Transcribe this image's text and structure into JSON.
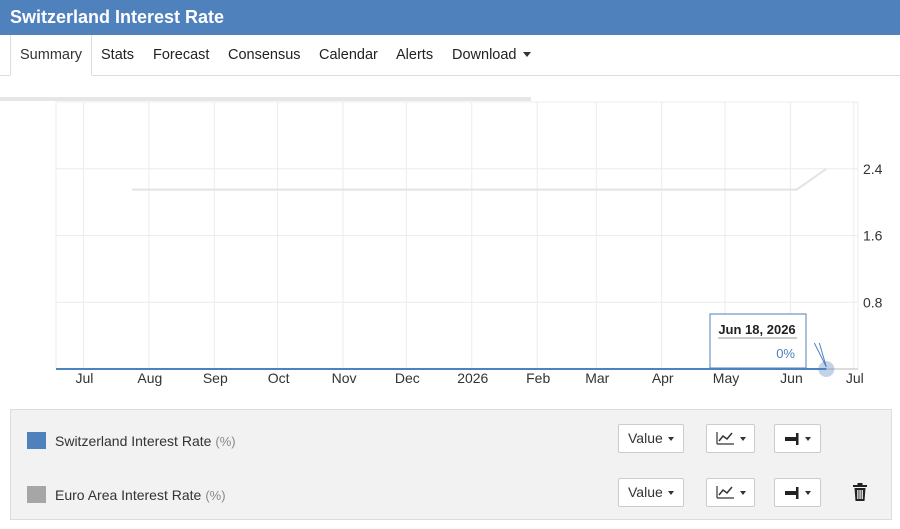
{
  "page": {
    "title": "Switzerland Interest Rate"
  },
  "tabs": [
    {
      "label": "Summary",
      "active": true
    },
    {
      "label": "Stats"
    },
    {
      "label": "Forecast"
    },
    {
      "label": "Consensus"
    },
    {
      "label": "Calendar"
    },
    {
      "label": "Alerts"
    },
    {
      "label": "Download",
      "dropdown": true
    }
  ],
  "chart_data": {
    "type": "line",
    "x_ticks": [
      "Jul",
      "Aug",
      "Sep",
      "Oct",
      "Nov",
      "Dec",
      "2026",
      "Feb",
      "Mar",
      "Apr",
      "May",
      "Jun",
      "Jul"
    ],
    "y_ticks": [
      0.8,
      1.6,
      2.4
    ],
    "ylim": [
      0,
      3.2
    ],
    "x_range": [
      "2025-06-18",
      "2026-07-03"
    ],
    "grid": true,
    "series": [
      {
        "name": "Switzerland Interest Rate",
        "color": "#4f81bd",
        "points": [
          [
            "2025-06-18",
            0
          ],
          [
            "2026-06-18",
            0
          ]
        ]
      },
      {
        "name": "Euro Area Interest Rate",
        "color": "#e3e3e3",
        "points": [
          [
            "2025-07-24",
            2.15
          ],
          [
            "2026-06-04",
            2.15
          ],
          [
            "2026-06-18",
            2.4
          ]
        ]
      }
    ],
    "tooltip": {
      "date": "Jun 18, 2026",
      "value": "0%"
    }
  },
  "legend": [
    {
      "name": "Switzerland Interest Rate",
      "unit": "(%)",
      "color": "#4f81bd",
      "value_label": "Value",
      "chart_type_icon": "line-chart-icon",
      "axis_icon": "axis-right-icon",
      "removable": false
    },
    {
      "name": "Euro Area Interest Rate",
      "unit": "(%)",
      "color": "#a6a6a6",
      "value_label": "Value",
      "chart_type_icon": "line-chart-icon",
      "axis_icon": "axis-right-icon",
      "removable": true,
      "remove_icon": "trash-icon"
    }
  ]
}
